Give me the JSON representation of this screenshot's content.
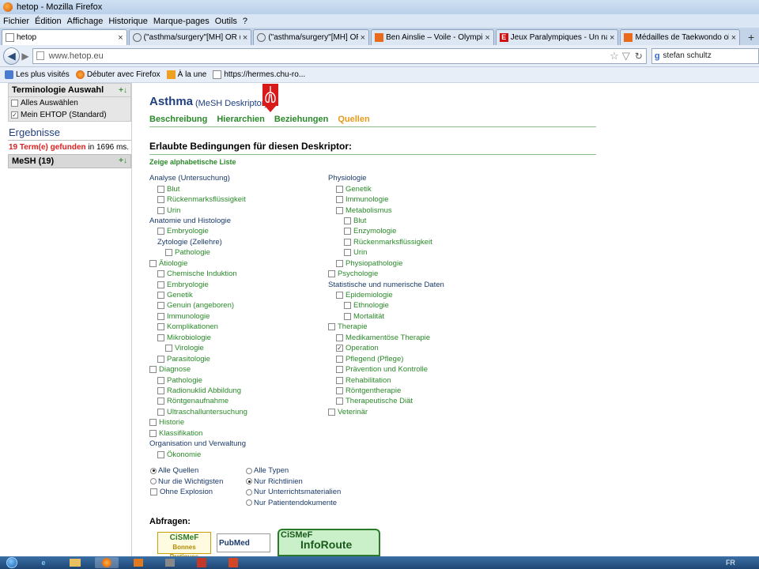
{
  "window": {
    "title": "hetop - Mozilla Firefox"
  },
  "menu": [
    "Fichier",
    "Édition",
    "Affichage",
    "Historique",
    "Marque-pages",
    "Outils",
    "?"
  ],
  "tabs": [
    {
      "label": "hetop",
      "active": true
    },
    {
      "label": "(\"asthma/surgery\"[MH] OR (((\"a...",
      "active": false
    },
    {
      "label": "(\"asthma/surgery\"[MH] OR (((\"a...",
      "active": false
    },
    {
      "label": "Ben Ainslie – Voile - Olympique ...",
      "active": false
    },
    {
      "label": "Jeux Paralympiques - Un nageur ...",
      "active": false
    },
    {
      "label": "Médailles de Taekwondo olympi...",
      "active": false
    }
  ],
  "tab_close": "×",
  "tab_new": "+",
  "nav": {
    "url": "www.hetop.eu",
    "search_user": "stefan schultz",
    "search_engine": "g"
  },
  "bookmarks": [
    "Les plus visités",
    "Débuter avec Firefox",
    "À la une",
    "https://hermes.chu-ro..."
  ],
  "sidebar": {
    "terminologie_title": "Terminologie Auswahl",
    "checkbox1": "Alles Auswählen",
    "checkbox2": "Mein EHTOP (Standard)",
    "ergebnisse": "Ergebnisse",
    "found_red": "19 Term(e) gefunden",
    "found_rest": " in 1696 ms.",
    "mesh": "MeSH (19)"
  },
  "main": {
    "title": "Asthma",
    "title_sub": "(MeSH Deskriptor)",
    "navlinks": [
      "Beschreibung",
      "Hierarchien",
      "Beziehungen",
      "Quellen"
    ],
    "heading": "Erlaubte Bedingungen für diesen Deskriptor:",
    "zeige": "Zeige alphabetische Liste",
    "abfragen": "Abfragen:"
  },
  "col1": [
    {
      "label": "Analyse (Untersuchung)",
      "level": 0,
      "cb": false,
      "kind": "cat"
    },
    {
      "label": "Blut",
      "level": 1,
      "cb": true
    },
    {
      "label": "Rückenmarksflüssigkeit",
      "level": 1,
      "cb": true
    },
    {
      "label": "Urin",
      "level": 1,
      "cb": true
    },
    {
      "label": "Anatomie und Histologie",
      "level": 0,
      "cb": false,
      "kind": "cat"
    },
    {
      "label": "Embryologie",
      "level": 1,
      "cb": true
    },
    {
      "label": "Zytologie (Zellehre)",
      "level": 1,
      "cb": false,
      "kind": "cat"
    },
    {
      "label": "Pathologie",
      "level": 2,
      "cb": true
    },
    {
      "label": "Ätiologie",
      "level": 0,
      "cb": true
    },
    {
      "label": "Chemische Induktion",
      "level": 1,
      "cb": true
    },
    {
      "label": "Embryologie",
      "level": 1,
      "cb": true
    },
    {
      "label": "Genetik",
      "level": 1,
      "cb": true
    },
    {
      "label": "Genuin (angeboren)",
      "level": 1,
      "cb": true
    },
    {
      "label": "Immunologie",
      "level": 1,
      "cb": true
    },
    {
      "label": "Komplikationen",
      "level": 1,
      "cb": true
    },
    {
      "label": "Mikrobiologie",
      "level": 1,
      "cb": true
    },
    {
      "label": "Virologie",
      "level": 2,
      "cb": true
    },
    {
      "label": "Parasitologie",
      "level": 1,
      "cb": true
    },
    {
      "label": "Diagnose",
      "level": 0,
      "cb": true
    },
    {
      "label": "Pathologie",
      "level": 1,
      "cb": true
    },
    {
      "label": "Radionuklid Abbildung",
      "level": 1,
      "cb": true
    },
    {
      "label": "Röntgenaufnahme",
      "level": 1,
      "cb": true
    },
    {
      "label": "Ultraschalluntersuchung",
      "level": 1,
      "cb": true
    },
    {
      "label": "Historie",
      "level": 0,
      "cb": true
    },
    {
      "label": "Klassifikation",
      "level": 0,
      "cb": true
    },
    {
      "label": "Organisation und Verwaltung",
      "level": 0,
      "cb": false,
      "kind": "cat"
    },
    {
      "label": "Ökonomie",
      "level": 1,
      "cb": true
    }
  ],
  "col2": [
    {
      "label": "Physiologie",
      "level": 0,
      "cb": false,
      "kind": "cat"
    },
    {
      "label": "Genetik",
      "level": 1,
      "cb": true
    },
    {
      "label": "Immunologie",
      "level": 1,
      "cb": true
    },
    {
      "label": "Metabolismus",
      "level": 1,
      "cb": true
    },
    {
      "label": "Blut",
      "level": 2,
      "cb": true
    },
    {
      "label": "Enzymologie",
      "level": 2,
      "cb": true
    },
    {
      "label": "Rückenmarksflüssigkeit",
      "level": 2,
      "cb": true
    },
    {
      "label": "Urin",
      "level": 2,
      "cb": true
    },
    {
      "label": "Physiopathologie",
      "level": 1,
      "cb": true
    },
    {
      "label": "Psychologie",
      "level": 0,
      "cb": true
    },
    {
      "label": "Statistische und numerische Daten",
      "level": 0,
      "cb": false,
      "kind": "cat"
    },
    {
      "label": "Epidemiologie",
      "level": 1,
      "cb": true
    },
    {
      "label": "Ethnologie",
      "level": 2,
      "cb": true
    },
    {
      "label": "Mortalität",
      "level": 2,
      "cb": true
    },
    {
      "label": "Therapie",
      "level": 0,
      "cb": true
    },
    {
      "label": "Medikamentöse Therapie",
      "level": 1,
      "cb": true
    },
    {
      "label": "Operation",
      "level": 1,
      "cb": true,
      "checked": true
    },
    {
      "label": "Pflegend (Pflege)",
      "level": 1,
      "cb": true
    },
    {
      "label": "Prävention und Kontrolle",
      "level": 1,
      "cb": true
    },
    {
      "label": "Rehabilitation",
      "level": 1,
      "cb": true
    },
    {
      "label": "Röntgentherapie",
      "level": 1,
      "cb": true
    },
    {
      "label": "Therapeutische Diät",
      "level": 1,
      "cb": true
    },
    {
      "label": "Veterinär",
      "level": 0,
      "cb": true
    }
  ],
  "options_left": [
    {
      "label": "Alle Quellen",
      "type": "radio",
      "on": true
    },
    {
      "label": "Nur die Wichtigsten",
      "type": "radio",
      "on": false
    },
    {
      "label": "Ohne Explosion",
      "type": "checkbox",
      "on": false
    }
  ],
  "options_right": [
    {
      "label": "Alle Typen",
      "on": false
    },
    {
      "label": "Nur Richtlinien",
      "on": true
    },
    {
      "label": "Nur Unterrichtsmaterialien",
      "on": false
    },
    {
      "label": "Nur Patientendokumente",
      "on": false
    }
  ],
  "logos": {
    "cismef_bp": "CiSMeF",
    "cismef_bp_sub": "Bonnes Pratiques",
    "pubmed": "PubMed",
    "inforoute_1": "CiSMeF",
    "inforoute_2": "InfoRoute"
  },
  "taskbar": {
    "tray": "FR"
  }
}
